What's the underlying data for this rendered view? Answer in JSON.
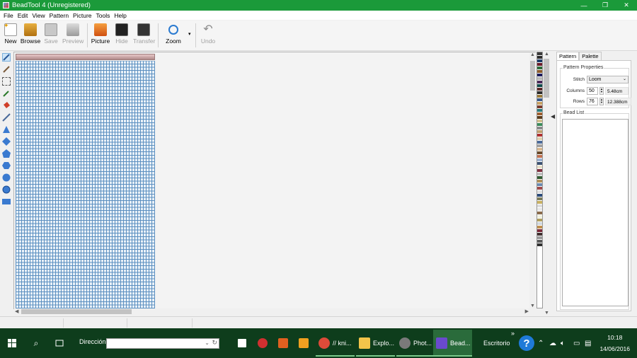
{
  "window": {
    "title": "BeadTool 4 (Unregistered)",
    "controls": {
      "minimize": "—",
      "maximize": "❐",
      "close": "✕"
    }
  },
  "menu": [
    "File",
    "Edit",
    "View",
    "Pattern",
    "Picture",
    "Tools",
    "Help"
  ],
  "toolbar": {
    "new": "New",
    "browse": "Browse",
    "save": "Save",
    "preview": "Preview",
    "picture": "Picture",
    "hide": "Hide",
    "transfer": "Transfer",
    "zoom": "Zoom",
    "undo": "Undo"
  },
  "panel": {
    "tabs": [
      "Pattern",
      "Palette"
    ],
    "properties_title": "Pattern Properties",
    "stitch_label": "Stitch",
    "stitch_value": "Loom",
    "columns_label": "Columns",
    "columns_value": "50",
    "columns_cm": "5.48cm",
    "rows_label": "Rows",
    "rows_value": "76",
    "rows_cm": "12.388cm",
    "bead_list_title": "Bead List"
  },
  "palette_colors": [
    "#3a3a3a",
    "#2b2b2b",
    "#1c3d6b",
    "#6b1c2a",
    "#2d6b3a",
    "#8a5a2a",
    "#1d1d5e",
    "#b8b8b8",
    "#4a2a5a",
    "#0e4a4a",
    "#5e2a2a",
    "#2a2a2a",
    "#9a7a3a",
    "#3a5a8a",
    "#c8a060",
    "#7a3a2a",
    "#2a7a7a",
    "#a06030",
    "#5a3a1a",
    "#d0c090",
    "#3a8a5a",
    "#8a8a8a",
    "#c0a070",
    "#b03030",
    "#e0d0b0",
    "#4a6a9a",
    "#a0a0a0",
    "#d8b890",
    "#6a4a2a",
    "#c07050",
    "#9ab0d0",
    "#3a5070",
    "#e8e0c8",
    "#803040",
    "#c0c0c0",
    "#305a30",
    "#b0905a",
    "#6a8ab0",
    "#a04a4a",
    "#e0e0e0",
    "#2a4a7a",
    "#7a7a5a",
    "#c8b060",
    "#dcdcdc",
    "#e8e8e8",
    "#8a6a4a",
    "#f0f0e0",
    "#b0a060",
    "#d0d8e0",
    "#c09050",
    "#7a2a3a",
    "#403030",
    "#9a9a9a",
    "#5a5a5a",
    "#303030"
  ],
  "taskbar": {
    "address_label": "Dirección",
    "address_value": "",
    "apps": [
      {
        "label": "// kni...",
        "color": "#dd4b39"
      },
      {
        "label": "Explo...",
        "color": "#f2c44a"
      },
      {
        "label": "Phot...",
        "color": "#7a7a7a"
      },
      {
        "label": "Bead...",
        "color": "#6a4acd"
      }
    ],
    "desktop_label": "Escritorio",
    "time": "10:18",
    "date": "14/06/2016"
  }
}
